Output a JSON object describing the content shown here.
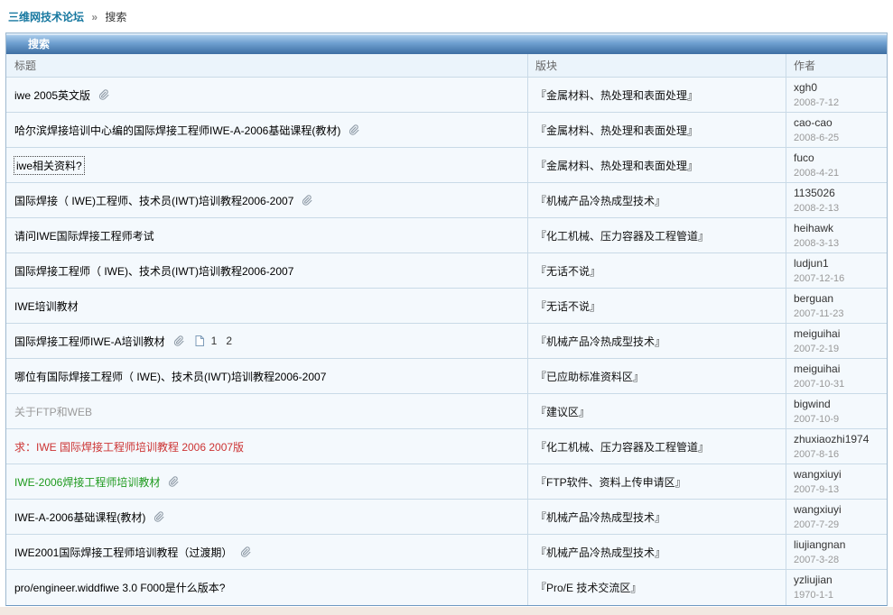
{
  "breadcrumb": {
    "forum": "三维网技术论坛",
    "separator": "»",
    "current": "搜索"
  },
  "panel": {
    "title": "搜索"
  },
  "table": {
    "headers": {
      "title": "标题",
      "forum": "版块",
      "author": "作者"
    },
    "rows": [
      {
        "title": "iwe 2005英文版",
        "attachment": true,
        "forum": "『金属材料、热处理和表面处理』",
        "author": "xgh0",
        "date": "2008-7-12"
      },
      {
        "title": "哈尔滨焊接培训中心编的国际焊接工程师IWE-A-2006基础课程(教材)",
        "attachment": true,
        "forum": "『金属材料、热处理和表面处理』",
        "author": "cao-cao",
        "date": "2008-6-25"
      },
      {
        "title": "iwe相关资料?",
        "focused": true,
        "forum": "『金属材料、热处理和表面处理』",
        "author": "fuco",
        "date": "2008-4-21"
      },
      {
        "title": "国际焊接（ IWE)工程师、技术员(IWT)培训教程2006-2007",
        "attachment": true,
        "forum": "『机械产品冷热成型技术』",
        "author": "1135026",
        "date": "2008-2-13"
      },
      {
        "title": "请问IWE国际焊接工程师考试",
        "forum": "『化工机械、压力容器及工程管道』",
        "author": "heihawk",
        "date": "2008-3-13"
      },
      {
        "title": "国际焊接工程师（ IWE)、技术员(IWT)培训教程2006-2007",
        "forum": "『无话不说』",
        "author": "ludjun1",
        "date": "2007-12-16"
      },
      {
        "title": "IWE培训教材",
        "forum": "『无话不说』",
        "author": "berguan",
        "date": "2007-11-23"
      },
      {
        "title": "国际焊接工程师IWE-A培训教材",
        "attachment": true,
        "pages": [
          "1",
          "2"
        ],
        "forum": "『机械产品冷热成型技术』",
        "author": "meiguihai",
        "date": "2007-2-19"
      },
      {
        "title": "哪位有国际焊接工程师（ IWE)、技术员(IWT)培训教程2006-2007",
        "forum": "『已应助标准资料区』",
        "author": "meiguihai",
        "date": "2007-10-31"
      },
      {
        "title": "关于FTP和WEB",
        "color": "grey",
        "forum": "『建议区』",
        "author": "bigwind",
        "date": "2007-10-9"
      },
      {
        "title": "求：IWE 国际焊接工程师培训教程 2006 2007版",
        "color": "red",
        "forum": "『化工机械、压力容器及工程管道』",
        "author": "zhuxiaozhi1974",
        "date": "2007-8-16"
      },
      {
        "title": "IWE-2006焊接工程师培训教材",
        "color": "green",
        "attachment": true,
        "forum": "『FTP软件、资料上传申请区』",
        "author": "wangxiuyi",
        "date": "2007-9-13"
      },
      {
        "title": "IWE-A-2006基础课程(教材)",
        "attachment": true,
        "forum": "『机械产品冷热成型技术』",
        "author": "wangxiuyi",
        "date": "2007-7-29"
      },
      {
        "title": "IWE2001国际焊接工程师培训教程（过渡期）",
        "attachment": true,
        "forum": "『机械产品冷热成型技术』",
        "author": "liujiangnan",
        "date": "2007-3-28"
      },
      {
        "title": "pro/engineer.widdfiwe 3.0 F000是什么版本?",
        "forum": "『Pro/E 技术交流区』",
        "author": "yzliujian",
        "date": "1970-1-1"
      }
    ]
  },
  "icons": {
    "attachment": "paperclip-icon",
    "multipage": "document-page-icon"
  },
  "colors": {
    "breadcrumb_link": "#1778A0",
    "header_gradient_top": "#A9CBEA",
    "header_gradient_bottom": "#3E6FA3",
    "table_header_bg": "#EBF4FB",
    "row_bg": "#F4F9FD",
    "border": "#C9DAE7",
    "title_grey": "#9A9A9A",
    "title_red": "#CC3333",
    "title_green": "#1E9A1E",
    "footer_bg": "#F2E9E2"
  }
}
